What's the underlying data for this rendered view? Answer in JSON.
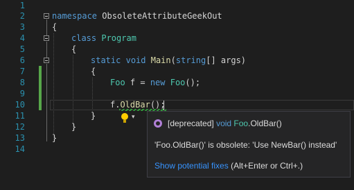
{
  "editor": {
    "lines": [
      {
        "num": "1"
      },
      {
        "num": "2"
      },
      {
        "num": "3"
      },
      {
        "num": "4"
      },
      {
        "num": "5"
      },
      {
        "num": "6"
      },
      {
        "num": "7"
      },
      {
        "num": "8"
      },
      {
        "num": "9"
      },
      {
        "num": "10"
      },
      {
        "num": "11"
      },
      {
        "num": "12"
      },
      {
        "num": "13"
      },
      {
        "num": "14"
      }
    ],
    "code": {
      "l2_kw": "namespace",
      "l2_name": "ObsoleteAttributeGeekOut",
      "l3": "{",
      "l4_kw": "class",
      "l4_name": "Program",
      "l5": "{",
      "l6_kw1": "static",
      "l6_kw2": "void",
      "l6_fn": "Main",
      "l6_p1": "(",
      "l6_kw3": "string",
      "l6_p2": "[] args)",
      "l7": "{",
      "l8_type": "Foo",
      "l8_mid": " f = ",
      "l8_kw": "new",
      "l8_sp": " ",
      "l8_type2": "Foo",
      "l8_end": "();",
      "l10_pre": "f.",
      "l10_fn": "OldBar",
      "l10_end": "();",
      "l11": "}",
      "l12": "}",
      "l13": "}"
    }
  },
  "lightbulb": {
    "icon": "lightbulb-icon",
    "dropdown": "▾"
  },
  "tooltip": {
    "tag": "[deprecated]",
    "kw": "void",
    "cls": "Foo",
    "member": ".OldBar()",
    "message": "'Foo.OldBar()' is obsolete: 'Use NewBar() instead'",
    "link_text": "Show potential fixes",
    "shortcut": "(Alt+Enter or Ctrl+.)"
  },
  "colors": {
    "background": "#1e1e1e",
    "line_number": "#2b91af",
    "keyword": "#569cd6",
    "type": "#4ec9b0",
    "method": "#dcdcaa",
    "change_marker": "#57a64a",
    "link": "#3794ff"
  }
}
